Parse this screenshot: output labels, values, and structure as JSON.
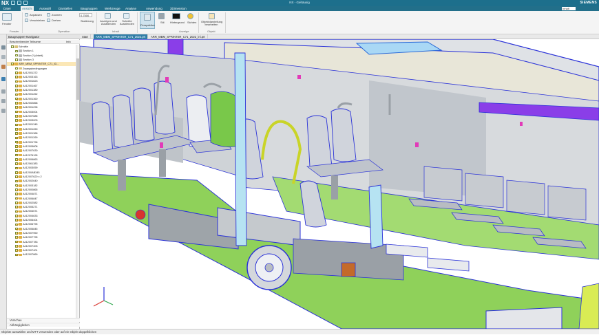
{
  "app": {
    "logo": "NX",
    "window_title": "NX - Gehäusig",
    "brand": "SIEMENS",
    "search_placeholder": "Inhalt"
  },
  "menu": [
    "Datei",
    "Ansicht",
    "Auswahl",
    "Darstellen",
    "Baugruppen",
    "Werkzeuge",
    "Analyse",
    "Anwendung",
    "3Dimension"
  ],
  "menu_active_index": 1,
  "ribbon": {
    "fenster": {
      "label": "Fenster",
      "button": "Fenster"
    },
    "operation": {
      "label": "Operation",
      "items": [
        "Anpassen",
        "Verschieben",
        "Zoomen",
        "Drehen"
      ],
      "scale_value": "0.7500",
      "scale_label": "Skalierung"
    },
    "inhalt": {
      "label": "Inhalt",
      "items": [
        "Anzeigen und Ausblenden",
        "Schnitte Ausblenden"
      ]
    },
    "perspective": "Perspektive",
    "anzeige": {
      "label": "Anzeige",
      "items": [
        "Stil",
        "Hintergrund",
        "Sichten"
      ]
    },
    "objekt": {
      "label": "Objekt",
      "item": "Objektdarstellung bearbeiten"
    }
  },
  "navigator": {
    "title": "Baugruppen-Navigator",
    "columns": [
      "Beschreibender Teilname",
      "Info"
    ],
    "rows": [
      {
        "label": "Schnitte",
        "level": 0,
        "kind": "folder",
        "sel": false
      },
      {
        "label": "Section 1",
        "level": 1,
        "kind": "section",
        "sel": false
      },
      {
        "label": "Section 2 (Arbeit)",
        "level": 1,
        "kind": "section",
        "sel": false
      },
      {
        "label": "Section 3",
        "level": 1,
        "kind": "section",
        "sel": false
      },
      {
        "label": "ARR_MBM_SPRINTER_C71_ID...",
        "level": 0,
        "kind": "assembly",
        "sel": true
      },
      {
        "label": "Zwangsbedingungen",
        "level": 1,
        "kind": "folder",
        "sel": false
      },
      {
        "label": "A412001372",
        "level": 1,
        "kind": "part"
      },
      {
        "label": "A412003163",
        "level": 1,
        "kind": "part"
      },
      {
        "label": "A412001623",
        "level": 1,
        "kind": "part"
      },
      {
        "label": "A412001467",
        "level": 1,
        "kind": "part"
      },
      {
        "label": "A412001380",
        "level": 1,
        "kind": "part"
      },
      {
        "label": "A412001262",
        "level": 1,
        "kind": "part"
      },
      {
        "label": "A412001360",
        "level": 1,
        "kind": "part"
      },
      {
        "label": "A412002868",
        "level": 1,
        "kind": "part"
      },
      {
        "label": "A412001296",
        "level": 1,
        "kind": "part"
      },
      {
        "label": "A412003004",
        "level": 1,
        "kind": "part"
      },
      {
        "label": "A412007685",
        "level": 1,
        "kind": "part"
      },
      {
        "label": "A412003003",
        "level": 1,
        "kind": "part"
      },
      {
        "label": "A412001345",
        "level": 1,
        "kind": "part"
      },
      {
        "label": "A412001260",
        "level": 1,
        "kind": "part"
      },
      {
        "label": "A412001368",
        "level": 1,
        "kind": "part"
      },
      {
        "label": "A412001269",
        "level": 1,
        "kind": "part"
      },
      {
        "label": "A412001796",
        "level": 1,
        "kind": "part"
      },
      {
        "label": "A412005808",
        "level": 1,
        "kind": "part"
      },
      {
        "label": "A412007630",
        "level": 1,
        "kind": "part"
      },
      {
        "label": "A412076195",
        "level": 1,
        "kind": "part"
      },
      {
        "label": "A412006863",
        "level": 1,
        "kind": "part"
      },
      {
        "label": "A412061383",
        "level": 1,
        "kind": "part"
      },
      {
        "label": "A412003059",
        "level": 1,
        "kind": "part"
      },
      {
        "label": "A41200AB345",
        "level": 1,
        "kind": "part"
      },
      {
        "label": "A412007620 x 2",
        "level": 1,
        "kind": "part"
      },
      {
        "label": "A412002640",
        "level": 1,
        "kind": "part"
      },
      {
        "label": "A412003182",
        "level": 1,
        "kind": "part"
      },
      {
        "label": "A412000865",
        "level": 1,
        "kind": "part"
      },
      {
        "label": "A412004871",
        "level": 1,
        "kind": "part"
      },
      {
        "label": "A412006847",
        "level": 1,
        "kind": "part"
      },
      {
        "label": "A412002582",
        "level": 1,
        "kind": "part"
      },
      {
        "label": "A412005271",
        "level": 1,
        "kind": "part"
      },
      {
        "label": "A412004571",
        "level": 1,
        "kind": "part"
      },
      {
        "label": "A412004633",
        "level": 1,
        "kind": "part"
      },
      {
        "label": "A412006404",
        "level": 1,
        "kind": "part"
      },
      {
        "label": "A412006795",
        "level": 1,
        "kind": "part"
      },
      {
        "label": "A412006845",
        "level": 1,
        "kind": "part"
      },
      {
        "label": "A412007950",
        "level": 1,
        "kind": "part"
      },
      {
        "label": "A412007795",
        "level": 1,
        "kind": "part"
      },
      {
        "label": "A412007783",
        "level": 1,
        "kind": "part"
      },
      {
        "label": "A412007403",
        "level": 1,
        "kind": "part"
      },
      {
        "label": "A412007401",
        "level": 1,
        "kind": "part"
      },
      {
        "label": "A412007869",
        "level": 1,
        "kind": "part"
      }
    ],
    "footer": [
      "Vorschau",
      "Abhängigkeiten"
    ]
  },
  "doc_tabs": [
    {
      "label": "Start",
      "active": false
    },
    {
      "label": "ARR_MBM_SPRINTER_C71_2022.prt",
      "active": true
    },
    {
      "label": "ARR_MBM_SPRINTER_C71_2022_ini.prt",
      "active": false
    }
  ],
  "status": "Objekte auswählen und MTT verwenden oder auf ein Objekt doppelklicken",
  "colors": {
    "accent": "#1d6f8c",
    "floor": "#8fd15a",
    "edges": "#1f2ad6",
    "seat_shell": "#d0d4dc",
    "purple": "#8a3ee8"
  }
}
